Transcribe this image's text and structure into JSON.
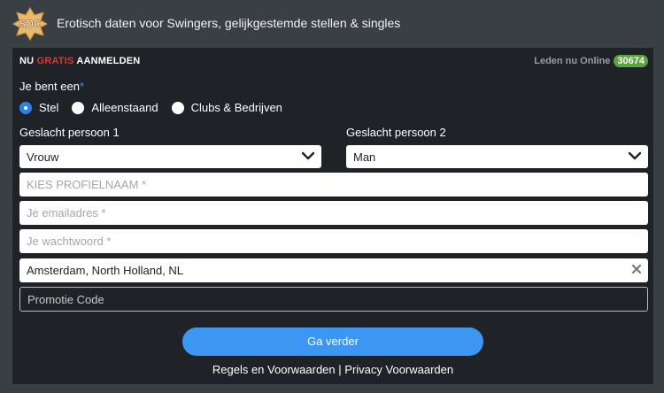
{
  "header": {
    "logo_text": "SDC",
    "tagline": "Erotisch daten voor Swingers, gelijkgestemde stellen & singles"
  },
  "panel": {
    "title_nu": "NU",
    "title_gratis": "GRATIS",
    "title_aanmelden": "AANMELDEN",
    "online_label": "Leden nu Online",
    "online_count": "30674"
  },
  "form": {
    "question": "Je bent een",
    "required_mark": "*",
    "radios": [
      {
        "label": "Stel",
        "checked": true
      },
      {
        "label": "Alleenstaand",
        "checked": false
      },
      {
        "label": "Clubs & Bedrijven",
        "checked": false
      }
    ],
    "gender1_label": "Geslacht persoon 1",
    "gender1_value": "Vrouw",
    "gender2_label": "Geslacht persoon 2",
    "gender2_value": "Man",
    "profile_placeholder": "KIES PROFIELNAAM *",
    "email_placeholder": "Je emailadres *",
    "password_placeholder": "Je wachtwoord *",
    "location_value": "Amsterdam, North Holland, NL",
    "promo_placeholder": "Promotie Code",
    "submit_label": "Ga verder",
    "terms_link": "Regels en Voorwaarden",
    "separator": "|",
    "privacy_link": "Privacy Voorwaarden"
  },
  "colors": {
    "accent_red": "#e8322e",
    "accent_blue": "#3d96f2",
    "online_green": "#5aa63c"
  }
}
